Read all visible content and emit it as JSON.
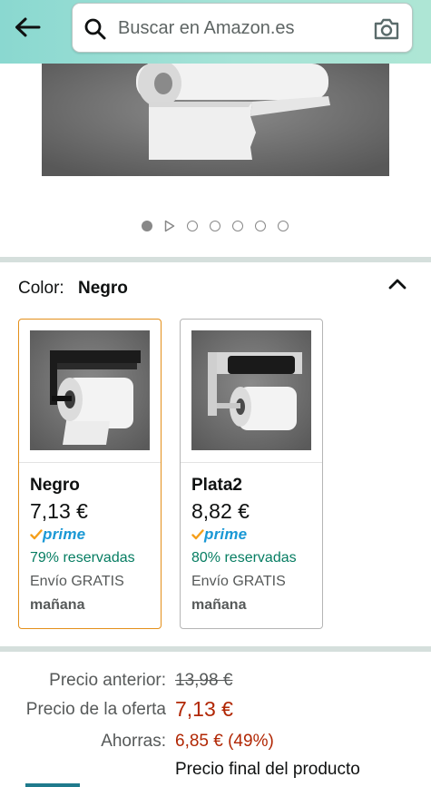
{
  "header": {
    "search_placeholder": "Buscar en Amazon.es"
  },
  "carousel": {
    "total_images": 7,
    "active_index": 0,
    "has_video": true
  },
  "color_selector": {
    "label": "Color:",
    "selected": "Negro",
    "options": [
      {
        "name": "Negro",
        "price": "7,13 €",
        "prime": "prime",
        "reserved": "79% reservadas",
        "shipping": "Envío GRATIS",
        "delivery": "mañana",
        "selected": true
      },
      {
        "name": "Plata2",
        "price": "8,82 €",
        "prime": "prime",
        "reserved": "80% reservadas",
        "shipping": "Envío GRATIS",
        "delivery": "mañana",
        "selected": false
      }
    ]
  },
  "pricing": {
    "previous_label": "Precio anterior:",
    "previous_value": "13,98 €",
    "deal_label": "Precio de la oferta",
    "deal_value": "7,13 €",
    "savings_label": "Ahorras:",
    "savings_value": "6,85 € (49%)",
    "final_note": "Precio final del producto"
  },
  "colors": {
    "header_gradient_start": "#8ad8d0",
    "header_gradient_end": "#aee6d5",
    "selected_border": "#e48f1a",
    "prime_blue": "#1a98d5",
    "reserved_green": "#067d62",
    "deal_red": "#b12704"
  },
  "icons": {
    "back": "arrow-left-icon",
    "search": "magnifier-icon",
    "camera": "camera-icon",
    "collapse": "chevron-up-icon",
    "prime_check": "prime-check-icon"
  }
}
